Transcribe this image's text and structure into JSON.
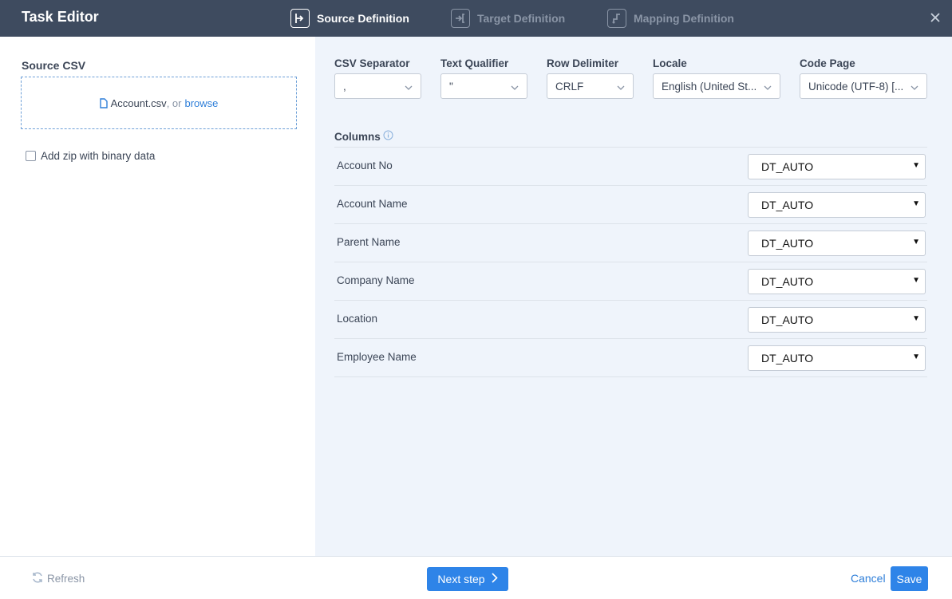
{
  "header": {
    "title": "Task Editor",
    "steps": [
      {
        "label": "Source Definition",
        "active": true,
        "icon": "source-step-icon"
      },
      {
        "label": "Target Definition",
        "active": false,
        "icon": "target-step-icon"
      },
      {
        "label": "Mapping Definition",
        "active": false,
        "icon": "mapping-step-icon"
      }
    ],
    "close_icon": "close-icon"
  },
  "source": {
    "label": "Source CSV",
    "filename": "Account.csv",
    "or_text": ", or",
    "browse_label": "browse",
    "zip_label": "Add zip with binary data",
    "zip_checked": false
  },
  "settings": {
    "csv_separator": {
      "label": "CSV Separator",
      "value": ","
    },
    "text_qualifier": {
      "label": "Text Qualifier",
      "value": "\""
    },
    "row_delimiter": {
      "label": "Row Delimiter",
      "value": "CRLF"
    },
    "locale": {
      "label": "Locale",
      "value": "English (United St..."
    },
    "code_page": {
      "label": "Code Page",
      "value": "Unicode (UTF-8) [..."
    }
  },
  "columns": {
    "label": "Columns",
    "rows": [
      {
        "name": "Account No",
        "type": "DT_AUTO"
      },
      {
        "name": "Account Name",
        "type": "DT_AUTO"
      },
      {
        "name": "Parent Name",
        "type": "DT_AUTO"
      },
      {
        "name": "Company Name",
        "type": "DT_AUTO"
      },
      {
        "name": "Location",
        "type": "DT_AUTO"
      },
      {
        "name": "Employee Name",
        "type": "DT_AUTO"
      }
    ]
  },
  "footer": {
    "refresh_label": "Refresh",
    "next_label": "Next step",
    "cancel_label": "Cancel",
    "save_label": "Save"
  },
  "colors": {
    "header_bg": "#3e4b5f",
    "accent": "#2e84e8",
    "link": "#2f7fd9",
    "panel_bg": "#eff4fb"
  }
}
